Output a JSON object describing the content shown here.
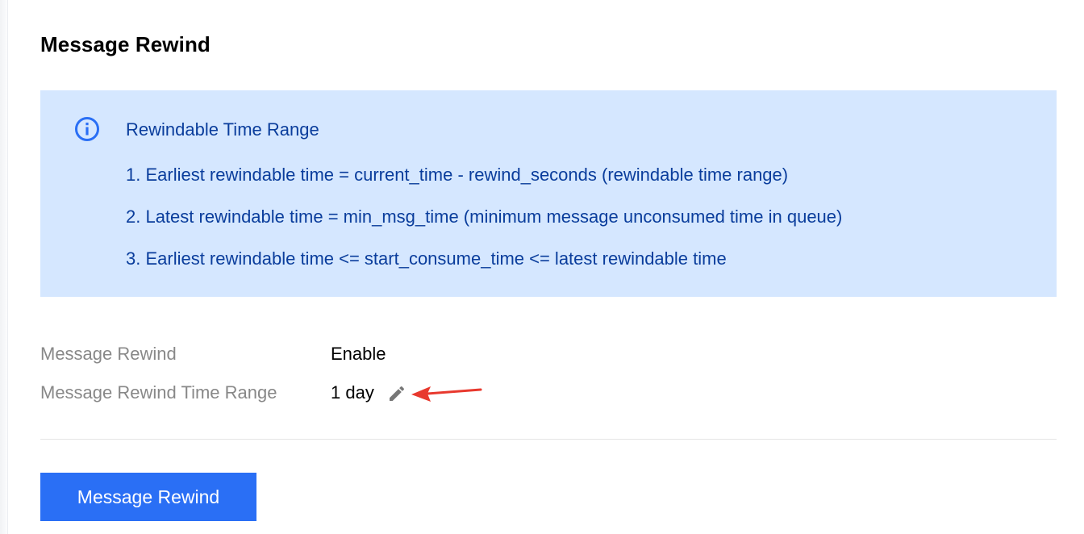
{
  "page": {
    "title": "Message Rewind"
  },
  "notice": {
    "icon": "info-circle-icon",
    "title": "Rewindable Time Range",
    "lines": [
      "1. Earliest rewindable time = current_time - rewind_seconds (rewindable time range)",
      "2. Latest rewindable time = min_msg_time (minimum message unconsumed time in queue)",
      "3. Earliest rewindable time <= start_consume_time <= latest rewindable time"
    ]
  },
  "fields": [
    {
      "label": "Message Rewind",
      "value": "Enable"
    },
    {
      "label": "Message Rewind Time Range",
      "value": "1 day",
      "edit_icon": "pencil-icon"
    }
  ],
  "annotation": {
    "icon": "red-arrow-icon",
    "color": "#e8392e"
  },
  "actions": {
    "primary_label": "Message Rewind"
  },
  "colors": {
    "accent": "#2a6ff5",
    "notice_bg": "#d5e7ff",
    "notice_text": "#0a3d9c",
    "label_gray": "#888888"
  }
}
